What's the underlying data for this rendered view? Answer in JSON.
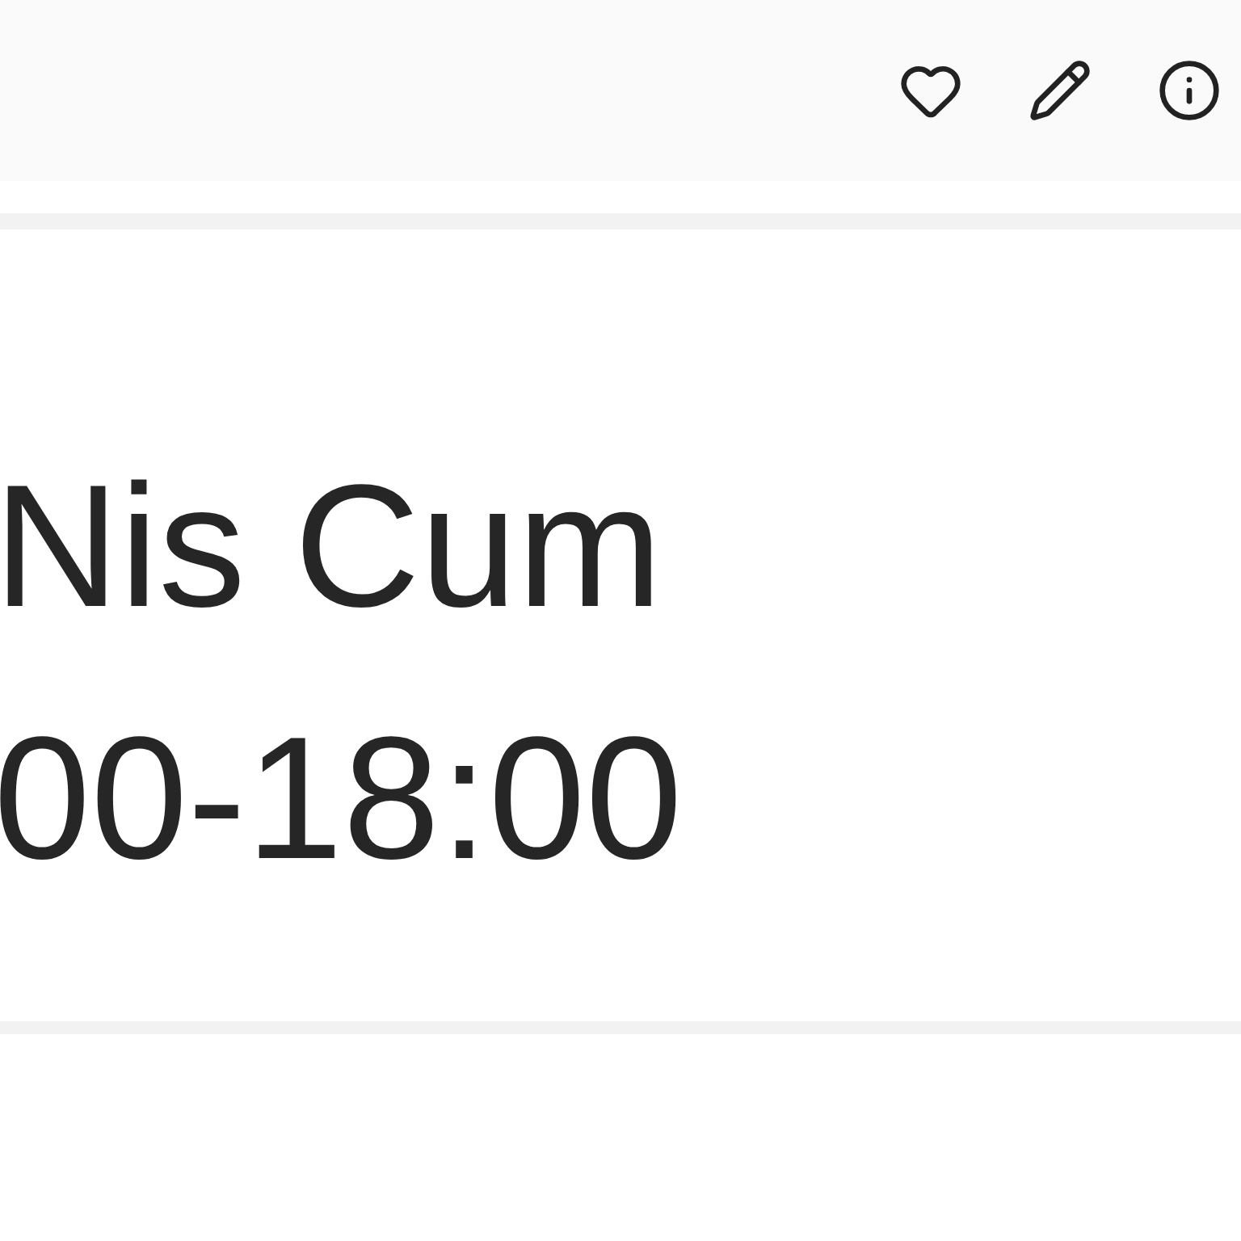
{
  "toolbar": {
    "actions": [
      {
        "kind": "favorite"
      },
      {
        "kind": "edit"
      },
      {
        "kind": "info"
      }
    ]
  },
  "card": {
    "title": "Nis Cum",
    "hours": "00-18:00"
  }
}
